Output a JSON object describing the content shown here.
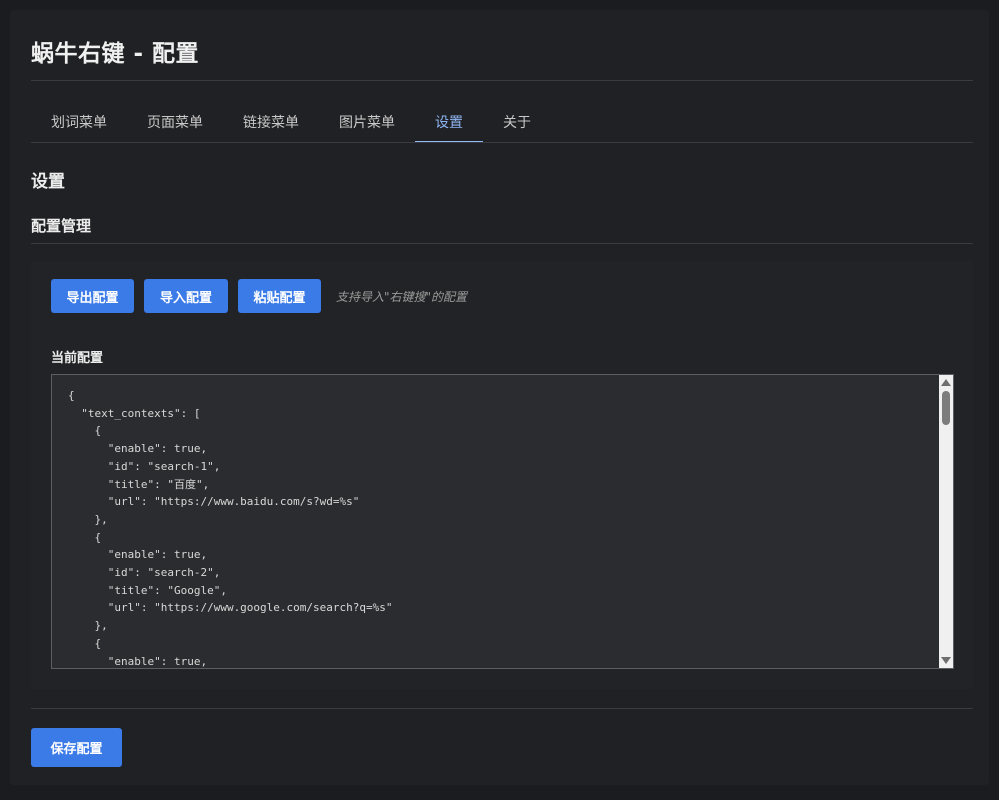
{
  "page": {
    "title": "蜗牛右键 - 配置"
  },
  "tabs": [
    {
      "label": "划词菜单"
    },
    {
      "label": "页面菜单"
    },
    {
      "label": "链接菜单"
    },
    {
      "label": "图片菜单"
    },
    {
      "label": "设置",
      "active": true
    },
    {
      "label": "关于"
    }
  ],
  "settings": {
    "heading": "设置",
    "config_management": "配置管理",
    "buttons": {
      "export": "导出配置",
      "import": "导入配置",
      "paste": "粘贴配置"
    },
    "hint": "支持导入\"右键搜\"的配置",
    "current_config_label": "当前配置",
    "config_text": "{\n  \"text_contexts\": [\n    {\n      \"enable\": true,\n      \"id\": \"search-1\",\n      \"title\": \"百度\",\n      \"url\": \"https://www.baidu.com/s?wd=%s\"\n    },\n    {\n      \"enable\": true,\n      \"id\": \"search-2\",\n      \"title\": \"Google\",\n      \"url\": \"https://www.google.com/search?q=%s\"\n    },\n    {\n      \"enable\": true,"
  },
  "footer": {
    "save": "保存配置"
  },
  "colors": {
    "accent": "#3b7be8",
    "active_tab": "#8fb6f5",
    "background": "#202124"
  }
}
